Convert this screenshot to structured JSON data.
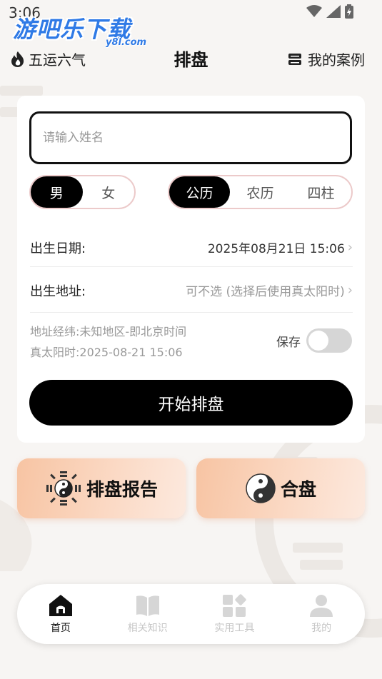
{
  "status_bar": {
    "time": "3:06"
  },
  "watermark": {
    "main": "游吧乐下载",
    "sub": "y8l.com"
  },
  "header": {
    "left_label": "五运六气",
    "title": "排盘",
    "right_label": "我的案例"
  },
  "form": {
    "name_placeholder": "请输入姓名",
    "gender_options": [
      "男",
      "女"
    ],
    "gender_selected": "男",
    "calendar_options": [
      "公历",
      "农历",
      "四柱"
    ],
    "calendar_selected": "公历",
    "birth_date": {
      "label": "出生日期:",
      "value": "2025年08月21日 15:06"
    },
    "birth_address": {
      "label": "出生地址:",
      "value": "可不选 (选择后使用真太阳时)"
    },
    "info_line1": "地址经纬:未知地区-即北京时间",
    "info_line2": "真太阳时:2025-08-21 15:06",
    "save_label": "保存",
    "save_enabled": false,
    "start_button": "开始排盘"
  },
  "features": {
    "report": "排盘报告",
    "hepan": "合盘"
  },
  "tabbar": {
    "items": [
      {
        "label": "首页",
        "icon": "home-icon",
        "active": true
      },
      {
        "label": "相关知识",
        "icon": "book-icon",
        "active": false
      },
      {
        "label": "实用工具",
        "icon": "tools-icon",
        "active": false
      },
      {
        "label": "我的",
        "icon": "user-icon",
        "active": false
      }
    ]
  },
  "colors": {
    "primary": "#000000",
    "segment_border": "#eccaca",
    "feature_gradient_start": "#f7c4a3",
    "feature_gradient_end": "#fce9de",
    "muted_text": "#999999"
  }
}
